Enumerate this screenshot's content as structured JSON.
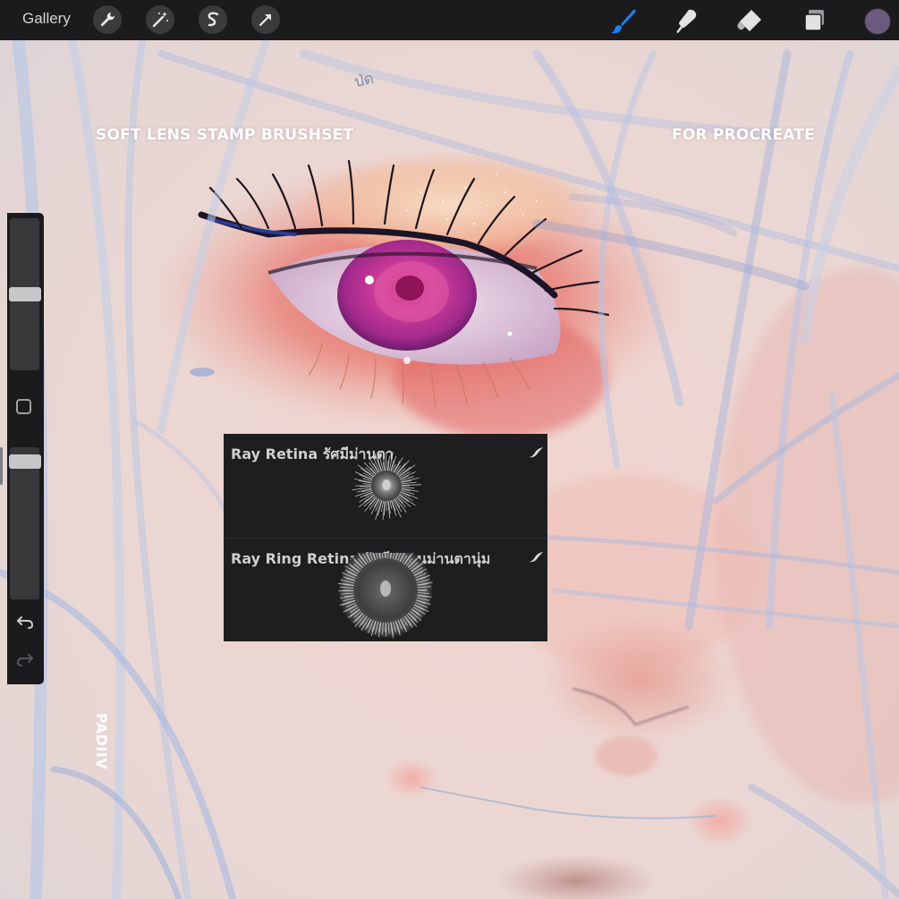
{
  "toolbar": {
    "gallery_label": "Gallery",
    "left_tools": [
      "wrench-icon",
      "magic-wand-icon",
      "selection-icon",
      "transform-arrow-icon"
    ],
    "right_tools": [
      "brush-icon",
      "smudge-icon",
      "eraser-icon",
      "layers-icon"
    ],
    "active_tool": "brush-icon",
    "accent_color": "#1e7ef0",
    "current_color": "#6a5a7e"
  },
  "canvas": {
    "title_left": "SOFT LENS STAMP BRUSHSET",
    "title_right": "FOR PROCREATE",
    "credit_vertical": "PADIIV",
    "sketch_scribble": "ป่ด"
  },
  "brush_panel": {
    "items": [
      {
        "name": "Ray Retina รัศมีม่านตา",
        "preview": "ray-burst"
      },
      {
        "name": "Ray Ring Retina รัศมีแหวนม่านตานุ่ม",
        "preview": "ray-ring"
      }
    ]
  },
  "sidebar": {
    "brush_size_level": 0.5,
    "opacity_level": 0.05
  }
}
